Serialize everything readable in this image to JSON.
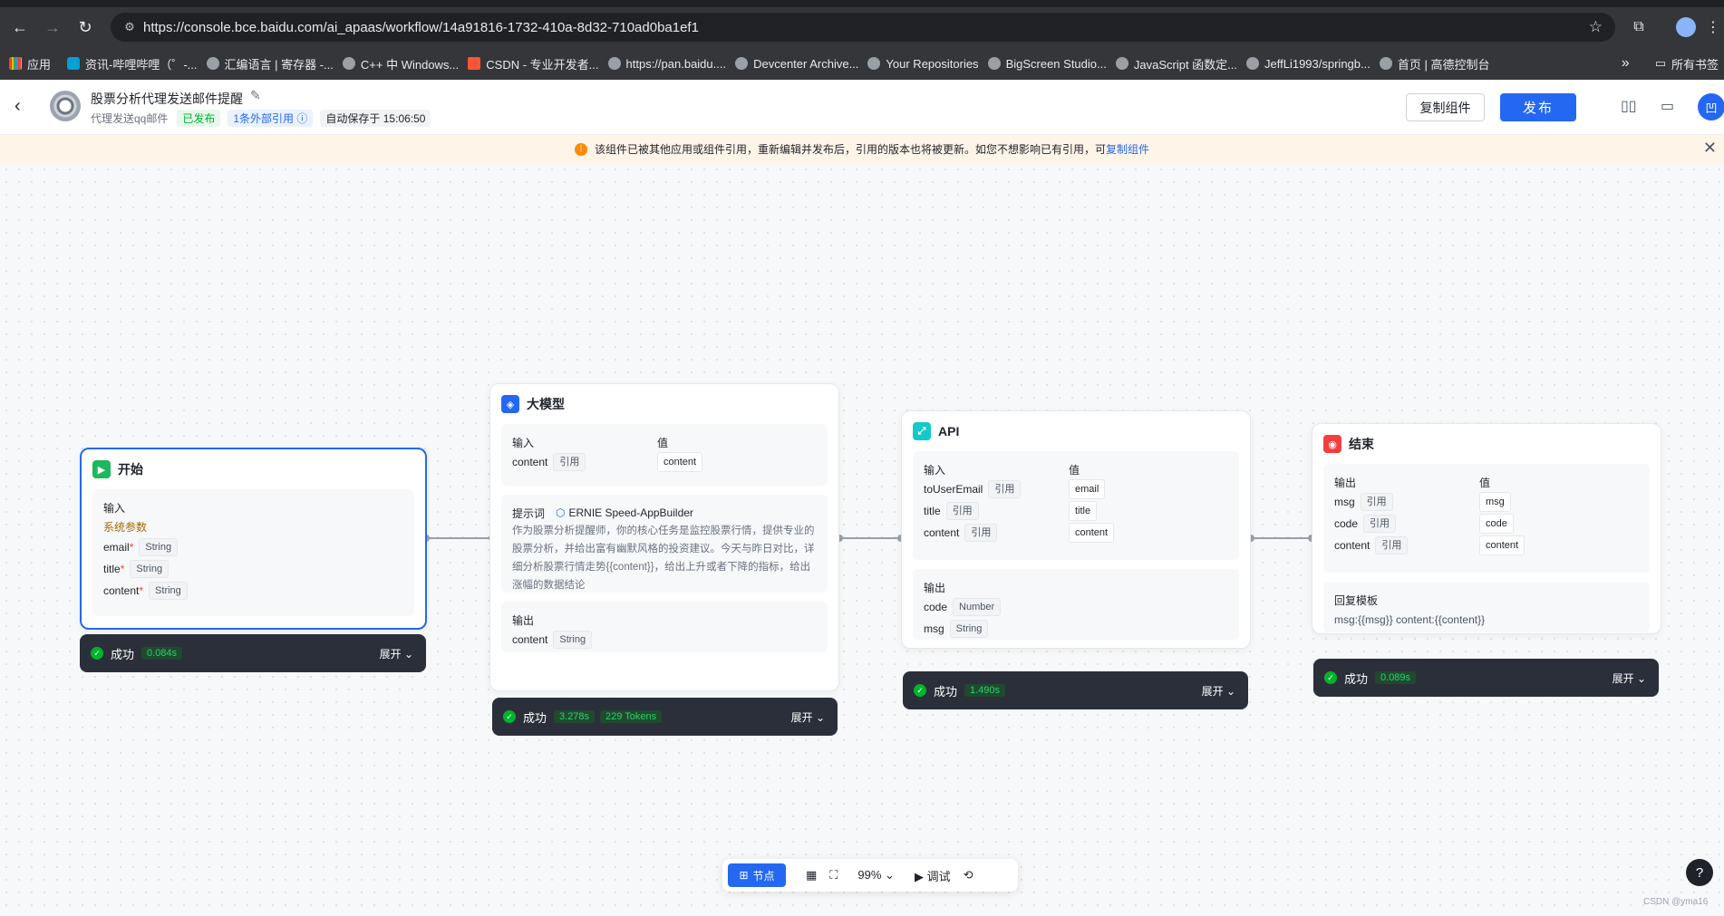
{
  "browser": {
    "url": "https://console.bce.baidu.com/ai_apaas/workflow/14a91816-1732-410a-8d32-710ad0ba1ef1",
    "bookmarks": [
      "应用",
      "资讯-哔哩哔哩（゜-...",
      "汇编语言 | 寄存器 -...",
      "C++ 中 Windows...",
      "CSDN - 专业开发者...",
      "https://pan.baidu....",
      "Devcenter Archive...",
      "Your Repositories",
      "BigScreen Studio...",
      "JavaScript 函数定...",
      "JeffLi1993/springb...",
      "首页 | 高德控制台"
    ],
    "bookmarks_more": "»",
    "all_bookmarks": "所有书签"
  },
  "header": {
    "title": "股票分析代理发送邮件提醒",
    "subtitle": "代理发送qq邮件",
    "status_tag": "已发布",
    "ref_tag": "1条外部引用",
    "autosave": "自动保存于 15:06:50",
    "copy_btn": "复制组件",
    "publish_btn": "发布",
    "avatar": "凹"
  },
  "notice": {
    "text": "该组件已被其他应用或组件引用，重新编辑并发布后，引用的版本也将被更新。如您不想影响已有引用，可",
    "link": "复制组件"
  },
  "nodes": {
    "start": {
      "title": "开始",
      "input_label": "输入",
      "sys_label": "系统参数",
      "params": [
        {
          "name": "email",
          "type": "String"
        },
        {
          "name": "title",
          "type": "String"
        },
        {
          "name": "content",
          "type": "String"
        }
      ],
      "status": "成功",
      "time": "0.084s",
      "expand": "展开"
    },
    "llm": {
      "title": "大模型",
      "input_label": "输入",
      "value_label": "值",
      "input_name": "content",
      "input_ref": "引用",
      "input_value": "content",
      "prompt_label": "提示词",
      "model": "ERNIE Speed-AppBuilder",
      "prompt": "作为股票分析提醒师，你的核心任务是监控股票行情，提供专业的股票分析，并给出富有幽默风格的投资建议。今天与昨日对比，详细分析股票行情走势{{content}}，给出上升或者下降的指标，给出涨幅的数据结论",
      "output_label": "输出",
      "output_name": "content",
      "output_type": "String",
      "status": "成功",
      "time": "3.278s",
      "tokens": "229 Tokens",
      "expand": "展开"
    },
    "api": {
      "title": "API",
      "input_label": "输入",
      "value_label": "值",
      "inputs": [
        {
          "name": "toUserEmail",
          "ref": "引用",
          "value": "email"
        },
        {
          "name": "title",
          "ref": "引用",
          "value": "title"
        },
        {
          "name": "content",
          "ref": "引用",
          "value": "content"
        }
      ],
      "output_label": "输出",
      "outputs": [
        {
          "name": "code",
          "type": "Number"
        },
        {
          "name": "msg",
          "type": "String"
        }
      ],
      "status": "成功",
      "time": "1.490s",
      "expand": "展开"
    },
    "end": {
      "title": "结束",
      "output_label": "输出",
      "value_label": "值",
      "outputs": [
        {
          "name": "msg",
          "ref": "引用",
          "value": "msg"
        },
        {
          "name": "code",
          "ref": "引用",
          "value": "code"
        },
        {
          "name": "content",
          "ref": "引用",
          "value": "content"
        }
      ],
      "template_label": "回复模板",
      "template": "msg:{{msg}} content:{{content}}",
      "status": "成功",
      "time": "0.089s",
      "expand": "展开"
    }
  },
  "bottom": {
    "node_btn": "节点",
    "zoom": "99%",
    "debug": "调试"
  },
  "help": "?",
  "watermark": "CSDN @yma16",
  "colors": {
    "accent": "#2468f2",
    "success": "#00b42a",
    "warning": "#ff8a00"
  }
}
